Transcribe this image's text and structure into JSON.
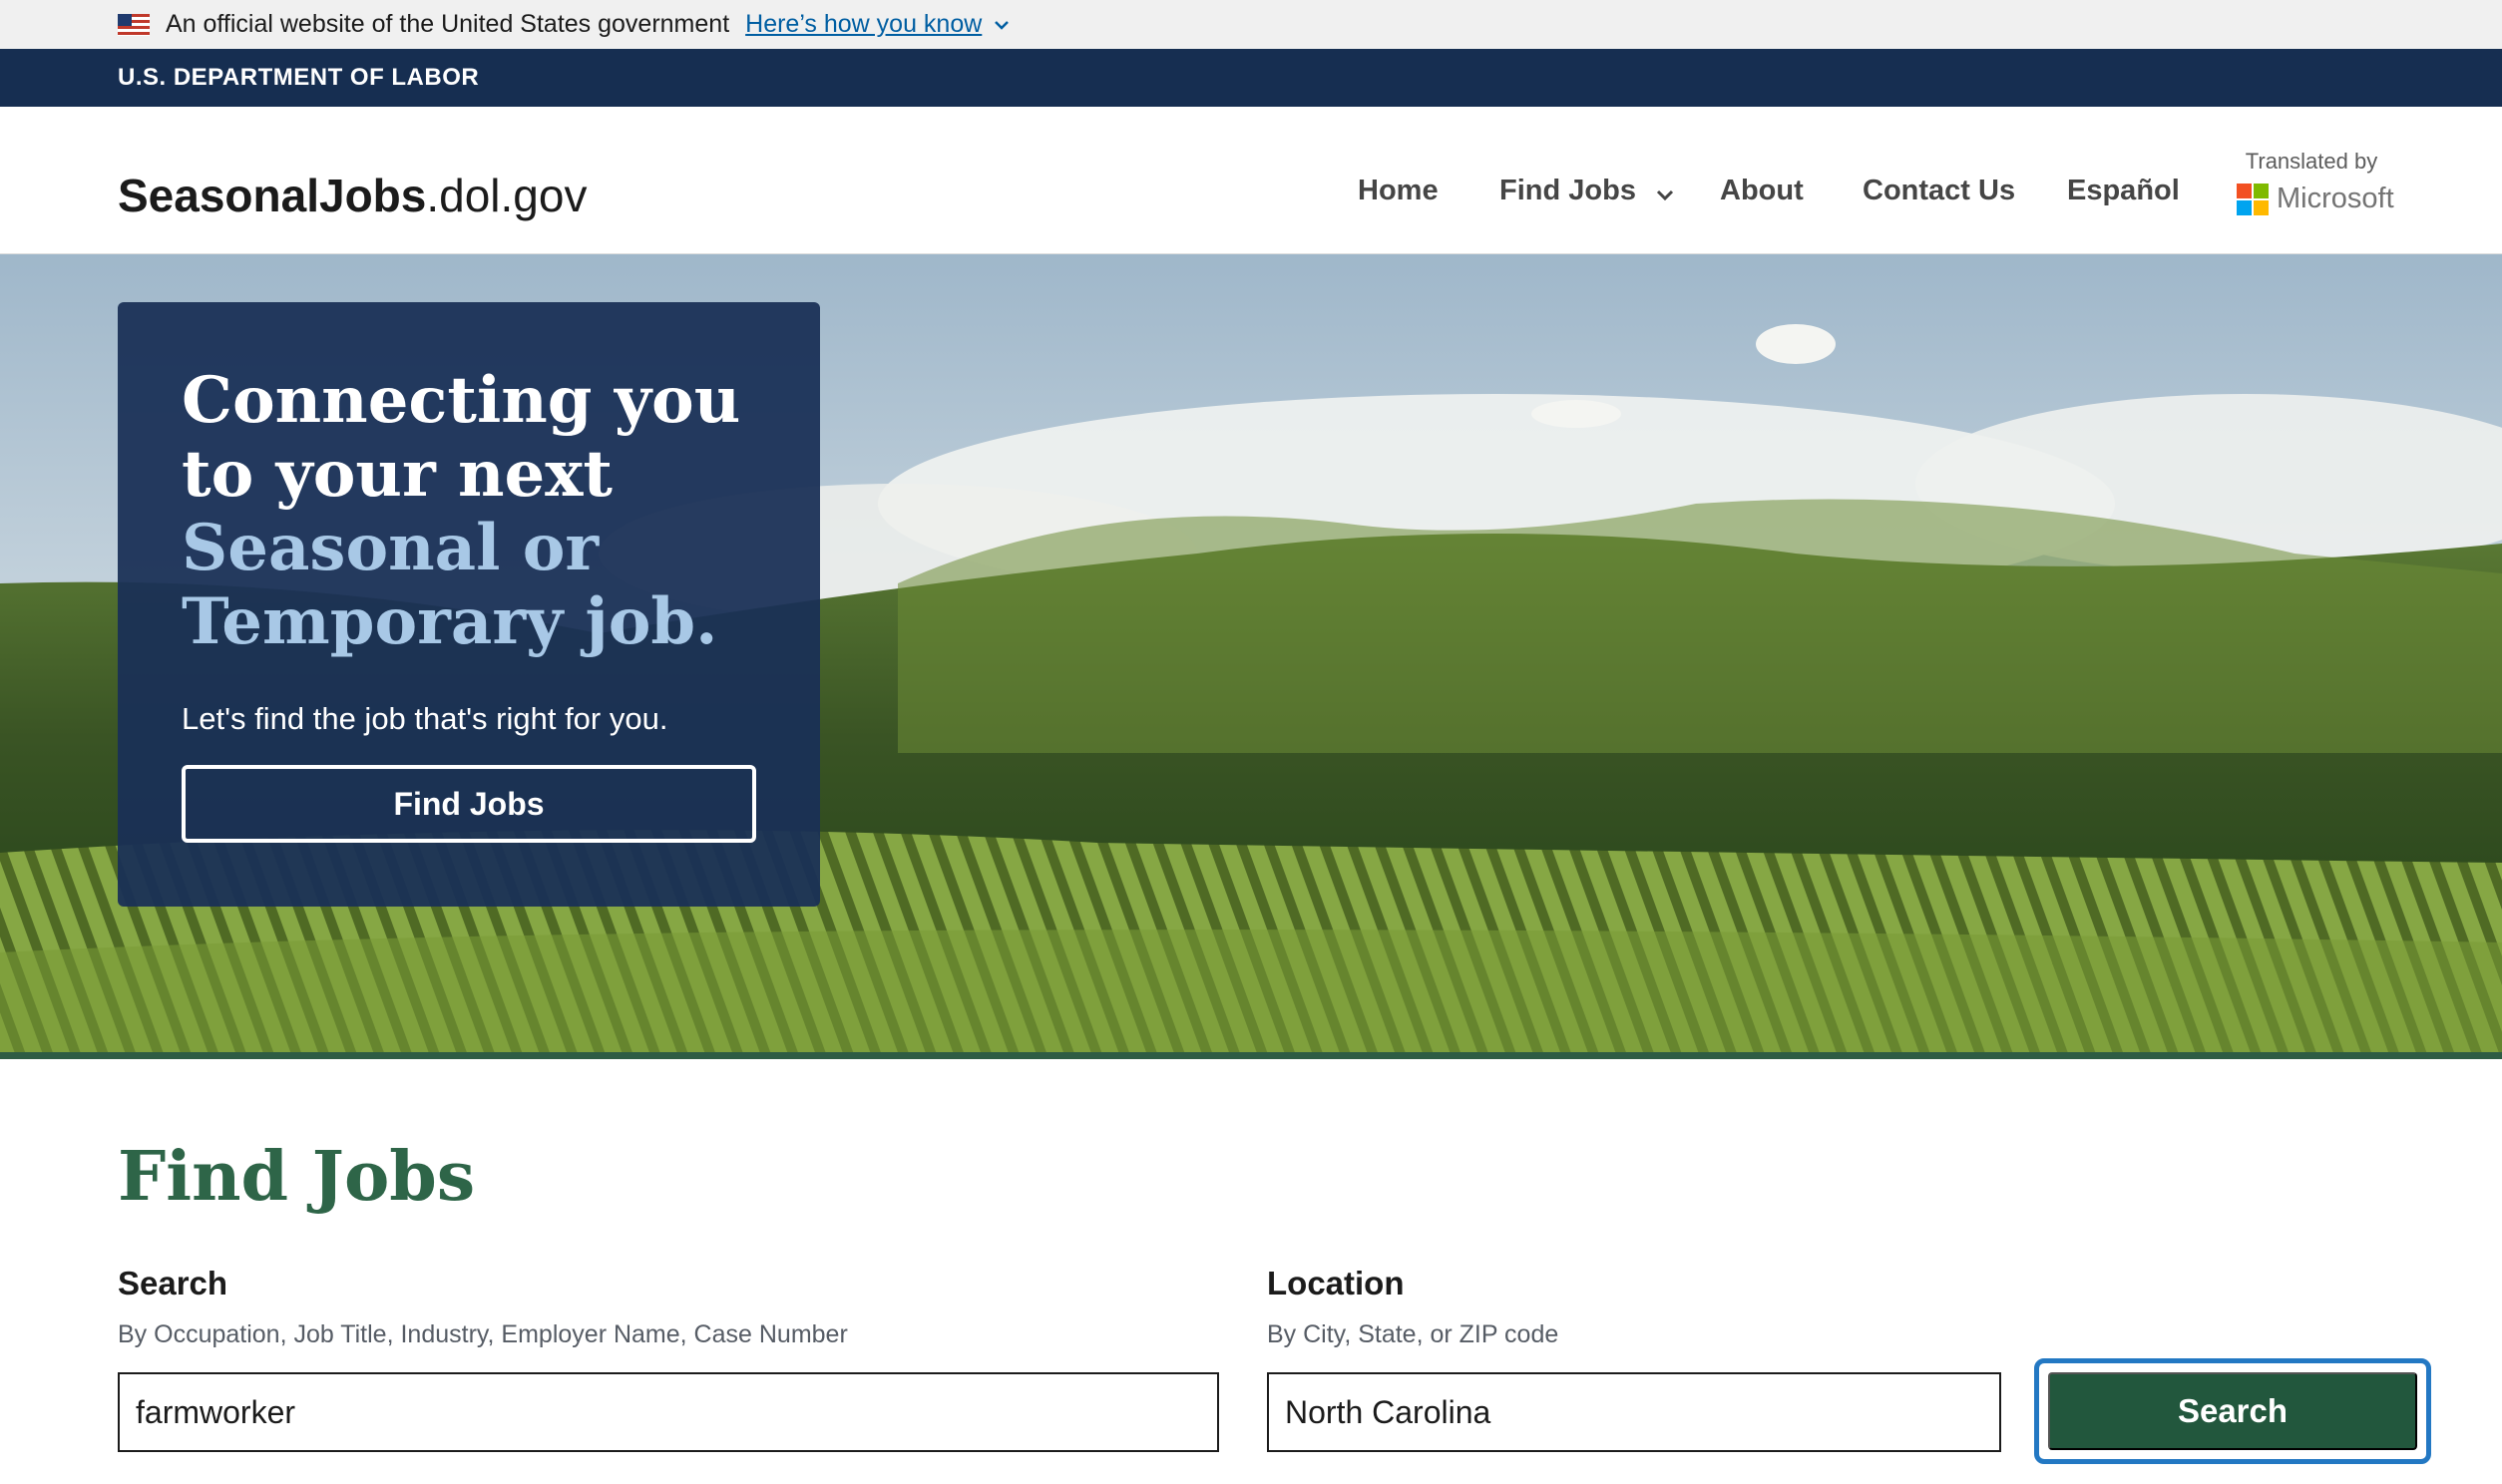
{
  "gov_banner": {
    "official_text": "An official website of the United States government",
    "how_you_know_link": "Here’s how you know"
  },
  "agency": {
    "name": "U.S. DEPARTMENT OF LABOR"
  },
  "header": {
    "logo_bold": "SeasonalJobs",
    "logo_light": ".dol.gov",
    "nav": {
      "home": "Home",
      "find_jobs": "Find Jobs",
      "about": "About",
      "contact": "Contact Us",
      "espanol": "Español"
    },
    "translated_by": "Translated by",
    "translator": "Microsoft"
  },
  "hero": {
    "title_line1": "Connecting you to your next",
    "title_accent": "Seasonal or Temporary job.",
    "subtitle": "Let's find the job that's right for you.",
    "button_label": "Find Jobs"
  },
  "find_jobs": {
    "heading": "Find Jobs",
    "search": {
      "label": "Search",
      "hint": "By Occupation, Job Title, Industry, Employer Name, Case Number",
      "value": "farmworker"
    },
    "location": {
      "label": "Location",
      "hint": "By City, State, or ZIP code",
      "value": "North Carolina"
    },
    "search_button": "Search"
  },
  "colors": {
    "agency_bar": "#162e51",
    "hero_card": "#1a3056",
    "accent_green": "#22573d",
    "heading_green": "#2e6548",
    "link_blue": "#005ea2",
    "focus_blue": "#2378c3"
  },
  "icons": [
    "us-flag-icon",
    "chevron-down-icon",
    "microsoft-logo-icon"
  ]
}
